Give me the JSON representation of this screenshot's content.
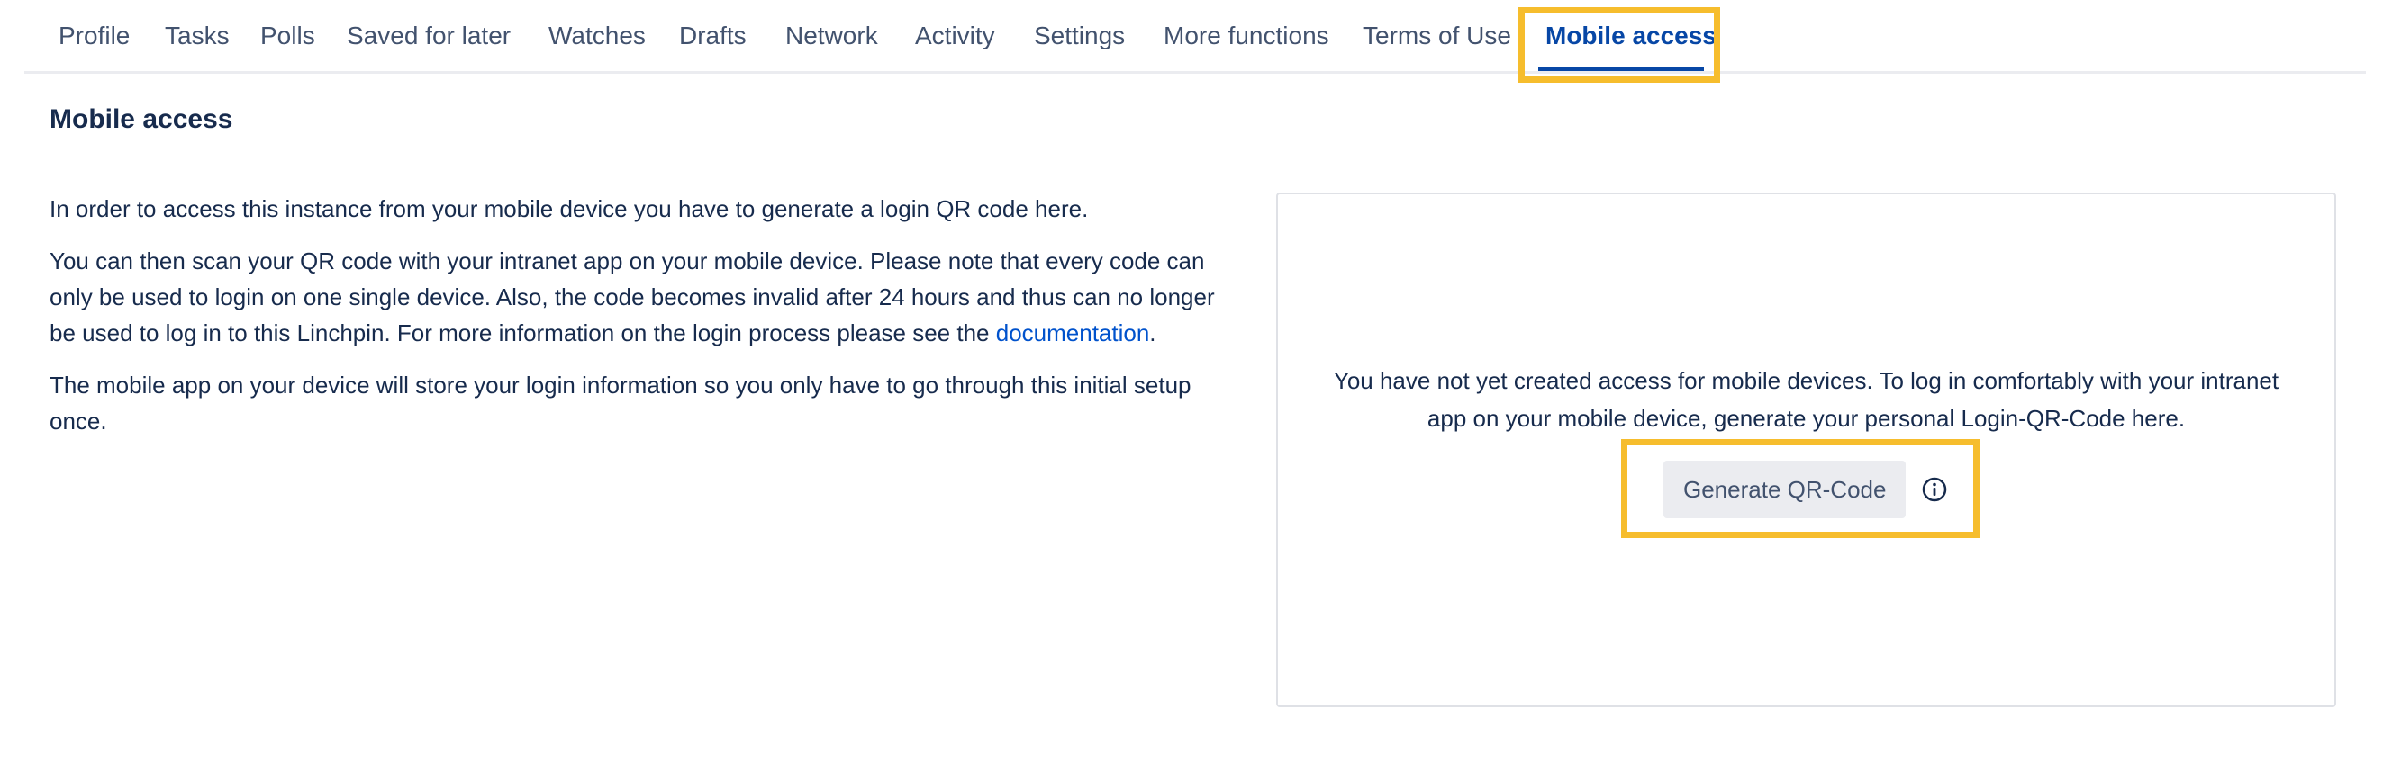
{
  "tabs": [
    {
      "label": "Profile"
    },
    {
      "label": "Tasks"
    },
    {
      "label": "Polls"
    },
    {
      "label": "Saved for later"
    },
    {
      "label": "Watches"
    },
    {
      "label": "Drafts"
    },
    {
      "label": "Network"
    },
    {
      "label": "Activity"
    },
    {
      "label": "Settings"
    },
    {
      "label": "More functions"
    },
    {
      "label": "Terms of Use"
    },
    {
      "label": "Mobile access",
      "active": true
    }
  ],
  "section": {
    "title": "Mobile access"
  },
  "intro": {
    "p1": "In order to access this instance from your mobile device you have to generate a login QR code here.",
    "p2_before": "You can then scan your QR code with your intranet app on your mobile device. Please note that every code can only be used to login on one single device. Also, the code becomes invalid after 24 hours and thus can no longer be used to log in to this Linchpin. For more information on the login process please see the ",
    "p2_link": "documentation",
    "p2_after": ".",
    "p3": "The mobile app on your device will store your login information so you only have to go through this initial setup once."
  },
  "access_box": {
    "message": "You have not yet created access for mobile devices. To log in comfortably with your intranet app on your mobile device, generate your personal Login-QR-Code here.",
    "button_label": "Generate QR-Code",
    "info_icon": "info-circle-icon"
  },
  "colors": {
    "highlight": "#f6bd2d",
    "active_tab": "#0747a6",
    "link": "#0052cc",
    "button_bg": "#ebecf0"
  }
}
